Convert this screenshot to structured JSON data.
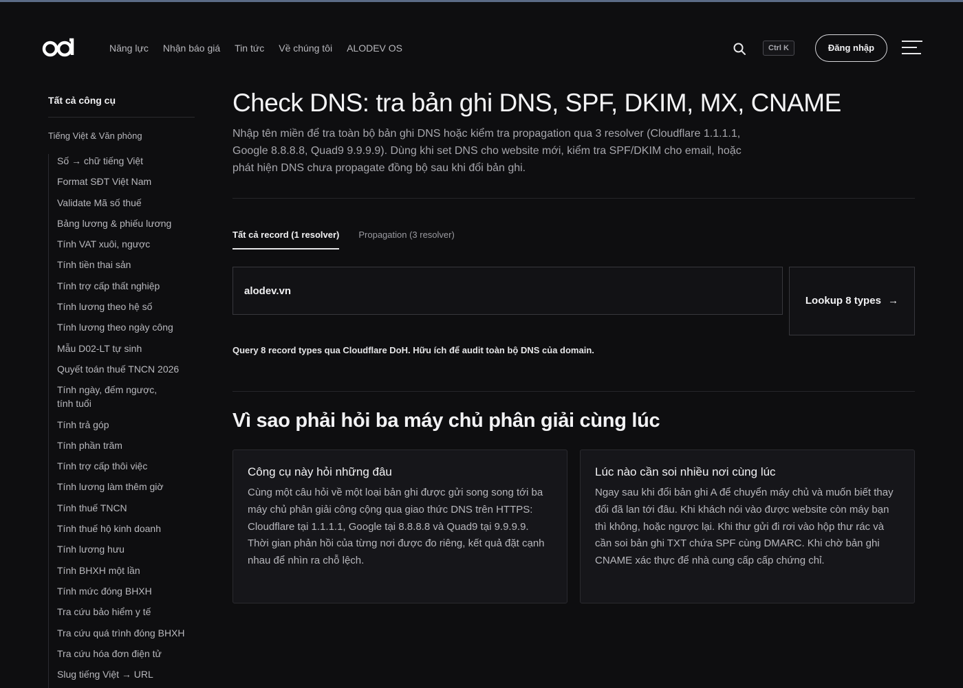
{
  "header": {
    "nav": [
      "Năng lực",
      "Nhận báo giá",
      "Tin tức",
      "Về chúng tôi",
      "ALODEV OS"
    ],
    "shortcut": "Ctrl K",
    "login_label": "Đăng nhập"
  },
  "sidebar": {
    "all_tools": "Tất cả công cụ",
    "group": "Tiếng Việt & Văn phòng",
    "items": [
      "Số → chữ tiếng Việt",
      "Format SĐT Việt Nam",
      "Validate Mã số thuế",
      "Bảng lương & phiếu lương",
      "Tính VAT xuôi, ngược",
      "Tính tiền thai sản",
      "Tính trợ cấp thất nghiệp",
      "Tính lương theo hệ số",
      "Tính lương theo ngày công",
      "Mẫu D02-LT tự sinh",
      "Quyết toán thuế TNCN 2026",
      "Tính ngày, đếm ngược, tính tuổi",
      "Tính trả góp",
      "Tính phần trăm",
      "Tính trợ cấp thôi việc",
      "Tính lương làm thêm giờ",
      "Tính thuế TNCN",
      "Tính thuế hộ kinh doanh",
      "Tính lương hưu",
      "Tính BHXH một lần",
      "Tính mức đóng BHXH",
      "Tra cứu bảo hiểm y tế",
      "Tra cứu quá trình đóng BHXH",
      "Tra cứu hóa đơn điện tử",
      "Slug tiếng Việt → URL"
    ]
  },
  "main": {
    "title": "Check DNS: tra bản ghi DNS, SPF, DKIM, MX, CNAME",
    "description": "Nhập tên miền để tra toàn bộ bản ghi DNS hoặc kiểm tra propagation qua 3 resolver (Cloudflare 1.1.1.1, Google 8.8.8.8, Quad9 9.9.9.9). Dùng khi set DNS cho website mới, kiểm tra SPF/DKIM cho email, hoặc phát hiện DNS chưa propagate đồng bộ sau khi đổi bản ghi.",
    "tabs": [
      "Tất cả record (1 resolver)",
      "Propagation (3 resolver)"
    ],
    "domain_value": "alodev.vn",
    "lookup_label": "Lookup 8 types",
    "hint": "Query 8 record types qua Cloudflare DoH. Hữu ích để audit toàn bộ DNS của domain.",
    "section_title": "Vì sao phải hỏi ba máy chủ phân giải cùng lúc",
    "cards": [
      {
        "title": "Công cụ này hỏi những đâu",
        "body": "Cùng một câu hỏi về một loại bản ghi được gửi song song tới ba máy chủ phân giải công cộng qua giao thức DNS trên HTTPS: Cloudflare tại 1.1.1.1, Google tại 8.8.8.8 và Quad9 tại 9.9.9.9. Thời gian phản hồi của từng nơi được đo riêng, kết quả đặt cạnh nhau để nhìn ra chỗ lệch."
      },
      {
        "title": "Lúc nào cần soi nhiều nơi cùng lúc",
        "body": "Ngay sau khi đổi bản ghi A để chuyển máy chủ và muốn biết thay đổi đã lan tới đâu. Khi khách nói vào được website còn máy bạn thì không, hoặc ngược lại. Khi thư gửi đi rơi vào hộp thư rác và cần soi bản ghi TXT chứa SPF cùng DMARC. Khi chờ bản ghi CNAME xác thực để nhà cung cấp cấp chứng chỉ."
      }
    ]
  }
}
